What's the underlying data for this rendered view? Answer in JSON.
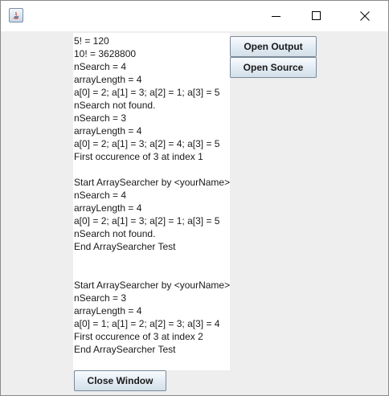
{
  "window": {
    "icon": "java-app-icon",
    "controls": {
      "minimize": "minimize-icon",
      "maximize": "maximize-icon",
      "close": "close-icon"
    }
  },
  "output": {
    "lines": [
      "5! = 120",
      "10! = 3628800",
      "nSearch = 4",
      "arrayLength = 4",
      "a[0] = 2; a[1] = 3; a[2] = 1; a[3] = 5",
      "nSearch not found.",
      "nSearch = 3",
      "arrayLength = 4",
      "a[0] = 2; a[1] = 3; a[2] = 4; a[3] = 5",
      "First occurence of 3 at index 1",
      "",
      "Start ArraySearcher by <yourName>",
      "nSearch = 4",
      "arrayLength = 4",
      "a[0] = 2; a[1] = 3; a[2] = 1; a[3] = 5",
      "nSearch not found.",
      "End ArraySearcher Test",
      "",
      "",
      "Start ArraySearcher by <yourName>",
      "nSearch = 3",
      "arrayLength = 4",
      "a[0] = 1; a[1] = 2; a[2] = 3; a[3] = 4",
      "First occurence of 3 at index 2",
      "End ArraySearcher Test"
    ]
  },
  "buttons": {
    "open_output": "Open Output",
    "open_source": "Open Source",
    "close_window": "Close Window"
  }
}
